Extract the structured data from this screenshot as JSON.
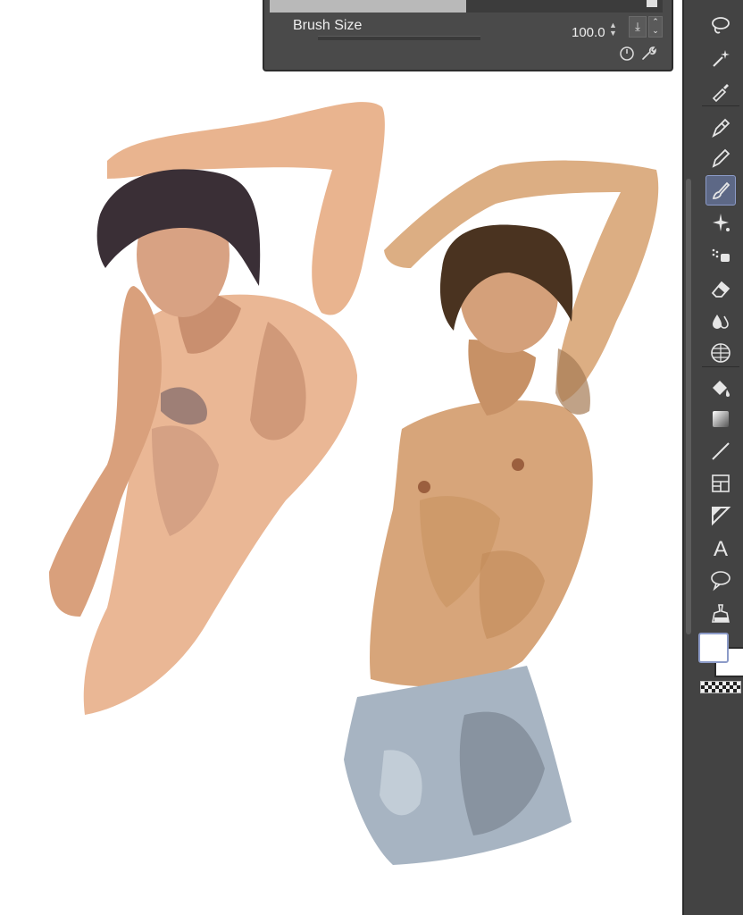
{
  "panel": {
    "label": "Brush Size",
    "value": "100.0",
    "top_slider_fraction": 0.5
  },
  "toolbar": {
    "tools": [
      "lasso-icon",
      "magic-wand-icon",
      "eyedropper-icon",
      "pen-icon",
      "pencil-icon",
      "brush-icon",
      "decoration-icon",
      "airbrush-icon",
      "eraser-icon",
      "blend-icon",
      "mesh-transform-icon",
      "fill-icon",
      "gradient-icon",
      "line-icon",
      "frame-icon",
      "ruler-icon",
      "text-icon",
      "balloon-icon",
      "correction-icon"
    ],
    "active_tool": "brush-icon"
  },
  "colors": {
    "main_color": "#ffffff",
    "sub_color": "#ffffff",
    "panel_bg": "#4a4a4a",
    "toolbar_bg": "#434343",
    "accent": "#8c9bc8"
  }
}
